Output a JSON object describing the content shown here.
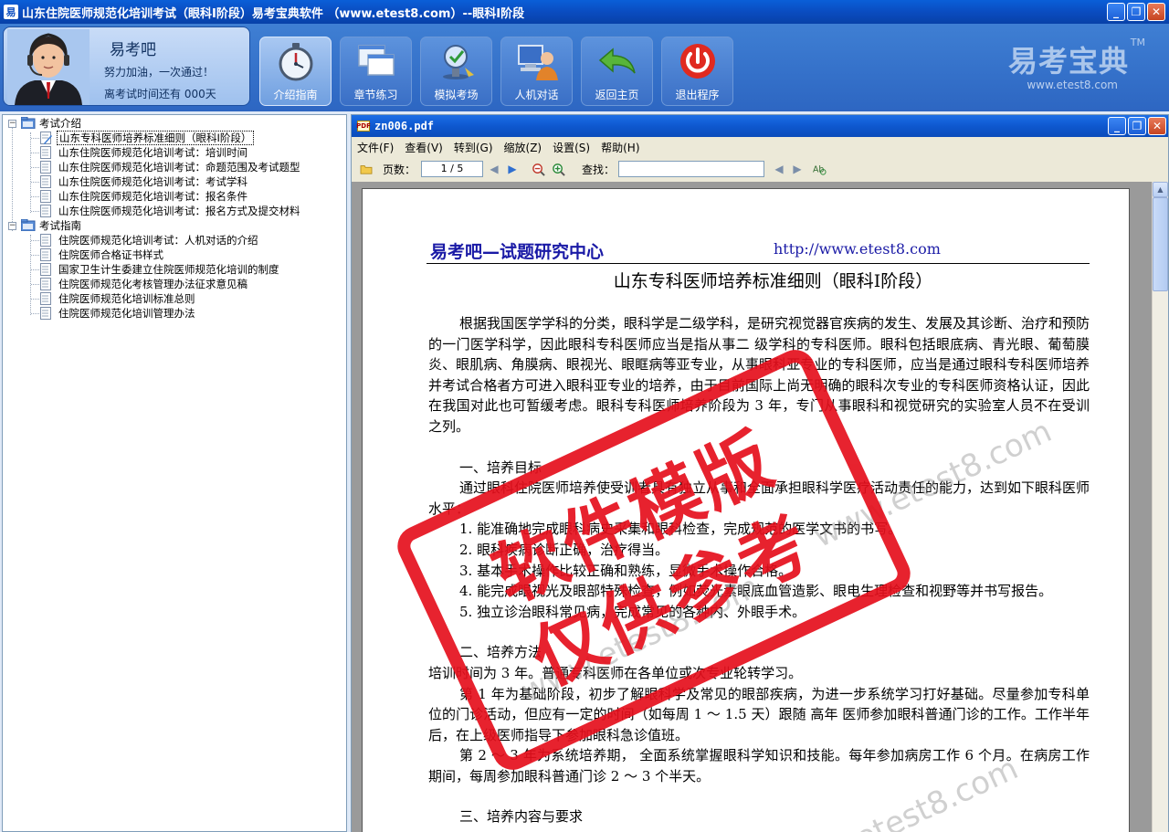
{
  "window": {
    "icon_text": "易",
    "title": "山东住院医师规范化培训考试（眼科Ⅰ阶段）易考宝典软件  （www.etest8.com）--眼科Ⅰ阶段",
    "min": "_",
    "max": "❐",
    "close": "✕"
  },
  "user": {
    "name": "易考吧",
    "slogan": "努力加油，一次通过！",
    "countdown": "离考试时间还有 000天"
  },
  "toolbar": {
    "items": [
      {
        "label": "介绍指南",
        "icon": "stopwatch-icon"
      },
      {
        "label": "章节练习",
        "icon": "windows-icon"
      },
      {
        "label": "模拟考场",
        "icon": "exam-icon"
      },
      {
        "label": "人机对话",
        "icon": "computer-user-icon"
      },
      {
        "label": "返回主页",
        "icon": "return-arrow-icon"
      },
      {
        "label": "退出程序",
        "icon": "power-icon"
      }
    ]
  },
  "brand": {
    "logo": "易考宝典",
    "tm": "TM",
    "url": "www.etest8.com"
  },
  "tree": {
    "groups": [
      {
        "label": "考试介绍",
        "items": [
          "山东专科医师培养标准细则（眼科Ⅰ阶段）",
          "山东住院医师规范化培训考试：培训时间",
          "山东住院医师规范化培训考试：命题范围及考试题型",
          "山东住院医师规范化培训考试：考试学科",
          "山东住院医师规范化培训考试：报名条件",
          "山东住院医师规范化培训考试：报名方式及提交材料"
        ]
      },
      {
        "label": "考试指南",
        "items": [
          "住院医师规范化培训考试：人机对话的介绍",
          "住院医师合格证书样式",
          "国家卫生计生委建立住院医师规范化培训的制度",
          "住院医师规范化考核管理办法征求意见稿",
          "住院医师规范化培训标准总则",
          "住院医师规范化培训管理办法"
        ]
      }
    ]
  },
  "pdf": {
    "filename": "zn006.pdf",
    "pdf_icon": "PDF",
    "menu": [
      "文件(F)",
      "查看(V)",
      "转到(G)",
      "缩放(Z)",
      "设置(S)",
      "帮助(H)"
    ],
    "page_label": "页数：",
    "page_value": "1 / 5",
    "find_label": "查找：",
    "find_value": ""
  },
  "document": {
    "header_left": "易考吧—试题研究中心",
    "header_right": "http://www.etest8.com",
    "title": "山东专科医师培养标准细则（眼科Ⅰ阶段）",
    "intro": "根据我国医学学科的分类，眼科学是二级学科，是研究视觉器官疾病的发生、发展及其诊断、治疗和预防的一门医学科学，因此眼科专科医师应当是指从事二 级学科的专科医师。眼科包括眼底病、青光眼、葡萄膜炎、眼肌病、角膜病、眼视光、眼眶病等亚专业，从事眼科亚专业的专科医师，应当是通过眼科专科医师培养 并考试合格者方可进入眼科亚专业的培养，由于目前国际上尚无明确的眼科次专业的专科医师资格认证，因此在我国对此也可暂缓考虑。眼科专科医师培养阶段为 3 年，专门从事眼科和视觉研究的实验室人员不在受训之列。",
    "sec1_title": "一、培养目标",
    "sec1_body": "通过眼科住院医师培养使受训者具有独立从事和全面承担眼科学医疗活动责任的能力，达到如下眼科医师水平：",
    "items": [
      "1.  能准确地完成眼科病史采集和眼科检查，完成规范的医学文书的书写。",
      "2.  眼科疾病诊断正确，治疗得当。",
      "3.  基本手术操作比较正确和熟练，显微手术操作合格。",
      "4.  能完成眼视光及眼部特殊检查，例如荧光素眼底血管造影、眼电生理检查和视野等并书写报告。",
      "5.  独立诊治眼科常见病，完成常见的各种内、外眼手术。"
    ],
    "sec2_title": "二、培养方法",
    "sec2_body": "培训时间为 3 年。普通专科医师在各单位或次专业轮转学习。",
    "sec2_p2": "第 1 年为基础阶段，初步了解眼科学及常见的眼部疾病，为进一步系统学习打好基础。尽量参加专科单位的门诊活动，但应有一定的时间（如每周 1 ～ 1.5 天）跟随 高年 医师参加眼科普通门诊的工作。工作半年后，在上级医师指导下参加眼科急诊值班。",
    "sec2_p3": "第 2 ～ 3 年为系统培养期， 全面系统掌握眼科学知识和技能。每年参加病房工作 6 个月。在病房工作期间，每周参加眼科普通门诊 2 ～ 3 个半天。",
    "sec3_title": "三、培养内容与要求"
  },
  "watermark": {
    "stamp_line1": "软件模版",
    "stamp_line2": "仅供参考",
    "wm1": "www.etest8.com",
    "wm2": "www.etest8.com",
    "wm3": "etest8.com"
  }
}
